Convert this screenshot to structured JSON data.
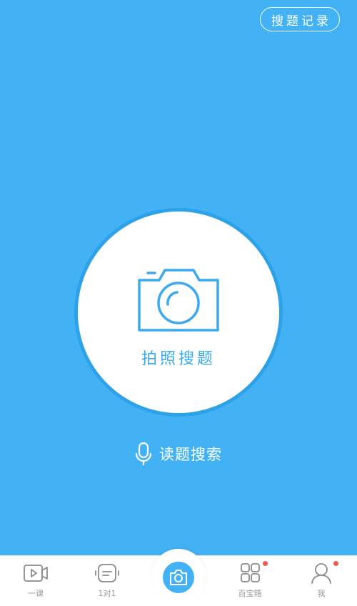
{
  "header": {
    "history_label": "搜题记录"
  },
  "main": {
    "camera_label": "拍照搜题",
    "voice_label": "读题搜索"
  },
  "colors": {
    "accent": "#43b2f4",
    "badge": "#ef5b4e"
  },
  "nav": {
    "items": [
      {
        "label": "一课",
        "icon": "video-icon"
      },
      {
        "label": "1对1",
        "icon": "tutor-icon"
      },
      {
        "label": "",
        "icon": "camera-icon"
      },
      {
        "label": "百宝箱",
        "icon": "grid-icon"
      },
      {
        "label": "我",
        "icon": "person-icon"
      }
    ]
  }
}
